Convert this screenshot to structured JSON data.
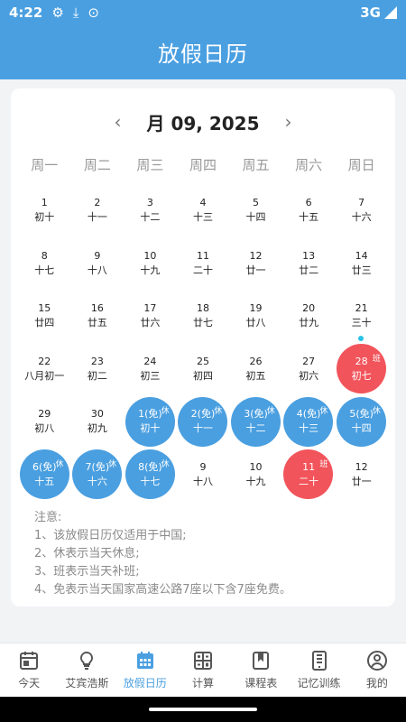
{
  "status": {
    "time": "4:22",
    "network": "3G"
  },
  "header": {
    "title": "放假日历"
  },
  "calendar": {
    "month_label": "月 09, 2025",
    "weekdays": [
      "周一",
      "周二",
      "周三",
      "周四",
      "周五",
      "周六",
      "周日"
    ],
    "rows": [
      [
        {
          "d": "1",
          "l": "初十"
        },
        {
          "d": "2",
          "l": "十一"
        },
        {
          "d": "3",
          "l": "十二"
        },
        {
          "d": "4",
          "l": "十三"
        },
        {
          "d": "5",
          "l": "十四"
        },
        {
          "d": "6",
          "l": "十五"
        },
        {
          "d": "7",
          "l": "十六"
        }
      ],
      [
        {
          "d": "8",
          "l": "十七"
        },
        {
          "d": "9",
          "l": "十八"
        },
        {
          "d": "10",
          "l": "十九"
        },
        {
          "d": "11",
          "l": "二十"
        },
        {
          "d": "12",
          "l": "廿一"
        },
        {
          "d": "13",
          "l": "廿二"
        },
        {
          "d": "14",
          "l": "廿三"
        }
      ],
      [
        {
          "d": "15",
          "l": "廿四"
        },
        {
          "d": "16",
          "l": "廿五"
        },
        {
          "d": "17",
          "l": "廿六"
        },
        {
          "d": "18",
          "l": "廿七"
        },
        {
          "d": "19",
          "l": "廿八"
        },
        {
          "d": "20",
          "l": "廿九"
        },
        {
          "d": "21",
          "l": "三十",
          "dot": true
        }
      ],
      [
        {
          "d": "22",
          "l": "八月初一"
        },
        {
          "d": "23",
          "l": "初二"
        },
        {
          "d": "24",
          "l": "初三"
        },
        {
          "d": "25",
          "l": "初四"
        },
        {
          "d": "26",
          "l": "初五"
        },
        {
          "d": "27",
          "l": "初六"
        },
        {
          "d": "28",
          "l": "初七",
          "type": "red",
          "badge": "班"
        }
      ],
      [
        {
          "d": "29",
          "l": "初八"
        },
        {
          "d": "30",
          "l": "初九"
        },
        {
          "d": "1(免)",
          "l": "初十",
          "type": "blue",
          "badge": "休"
        },
        {
          "d": "2(免)",
          "l": "十一",
          "type": "blue",
          "badge": "休"
        },
        {
          "d": "3(免)",
          "l": "十二",
          "type": "blue",
          "badge": "休"
        },
        {
          "d": "4(免)",
          "l": "十三",
          "type": "blue",
          "badge": "休"
        },
        {
          "d": "5(免)",
          "l": "十四",
          "type": "blue",
          "badge": "休"
        }
      ],
      [
        {
          "d": "6(免)",
          "l": "十五",
          "type": "blue",
          "badge": "休"
        },
        {
          "d": "7(免)",
          "l": "十六",
          "type": "blue",
          "badge": "休"
        },
        {
          "d": "8(免)",
          "l": "十七",
          "type": "blue",
          "badge": "休"
        },
        {
          "d": "9",
          "l": "十八"
        },
        {
          "d": "10",
          "l": "十九"
        },
        {
          "d": "11",
          "l": "二十",
          "type": "red",
          "badge": "班"
        },
        {
          "d": "12",
          "l": "廿一"
        }
      ]
    ]
  },
  "notes": {
    "title": "注意:",
    "lines": [
      "1、该放假日历仅适用于中国;",
      "2、休表示当天休息;",
      "3、班表示当天补班;",
      "4、免表示当天国家高速公路7座以下含7座免费。"
    ]
  },
  "tabs": [
    {
      "label": "今天",
      "icon": "calendar-today-icon"
    },
    {
      "label": "艾宾浩斯",
      "icon": "lightbulb-icon"
    },
    {
      "label": "放假日历",
      "icon": "calendar-grid-icon",
      "active": true
    },
    {
      "label": "计算",
      "icon": "calculator-icon"
    },
    {
      "label": "课程表",
      "icon": "bookmark-icon"
    },
    {
      "label": "记忆训练",
      "icon": "memory-card-icon"
    },
    {
      "label": "我的",
      "icon": "user-icon"
    }
  ],
  "colors": {
    "primary": "#4a9fe0",
    "holiday": "#4a9fe0",
    "workday": "#f2545b"
  }
}
